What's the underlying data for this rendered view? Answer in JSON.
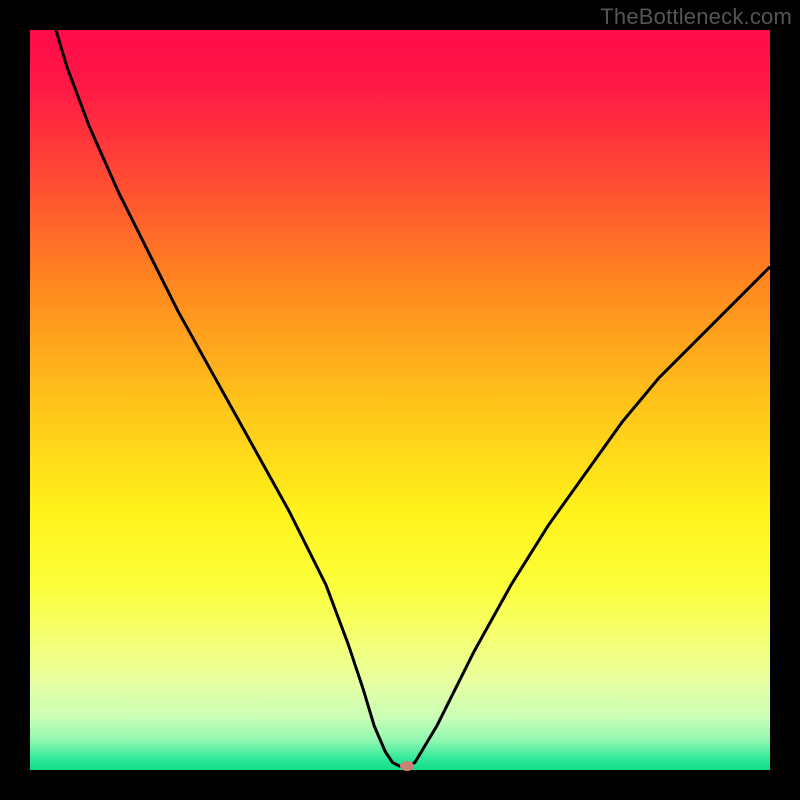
{
  "watermark": "TheBottleneck.com",
  "chart_data": {
    "type": "line",
    "title": "",
    "xlabel": "",
    "ylabel": "",
    "xlim": [
      0,
      100
    ],
    "ylim": [
      0,
      100
    ],
    "curve": {
      "x": [
        0,
        2,
        5,
        8,
        12,
        16,
        20,
        25,
        30,
        35,
        40,
        43,
        45,
        46.5,
        48,
        49,
        50,
        51,
        52,
        55,
        60,
        65,
        70,
        75,
        80,
        85,
        90,
        95,
        100
      ],
      "y": [
        115,
        105,
        95,
        87,
        78,
        70,
        62,
        53,
        44,
        35,
        25,
        17,
        11,
        6,
        2.5,
        1,
        0.5,
        0.5,
        1,
        6,
        16,
        25,
        33,
        40,
        47,
        53,
        58,
        63,
        68
      ]
    },
    "marker": {
      "x": 51,
      "y": 0.5,
      "color": "#c98374"
    },
    "gradient_stops": [
      {
        "offset": 0,
        "color": "#ff0b4a"
      },
      {
        "offset": 0.08,
        "color": "#ff1a45"
      },
      {
        "offset": 0.2,
        "color": "#ff4a33"
      },
      {
        "offset": 0.35,
        "color": "#ff8a1f"
      },
      {
        "offset": 0.5,
        "color": "#ffc21a"
      },
      {
        "offset": 0.65,
        "color": "#fff21a"
      },
      {
        "offset": 0.75,
        "color": "#fcff3a"
      },
      {
        "offset": 0.82,
        "color": "#f5ff70"
      },
      {
        "offset": 0.88,
        "color": "#e8ffa0"
      },
      {
        "offset": 0.93,
        "color": "#c8ffb8"
      },
      {
        "offset": 0.96,
        "color": "#90f8b0"
      },
      {
        "offset": 0.985,
        "color": "#30e89a"
      },
      {
        "offset": 1.0,
        "color": "#10dd88"
      }
    ]
  }
}
